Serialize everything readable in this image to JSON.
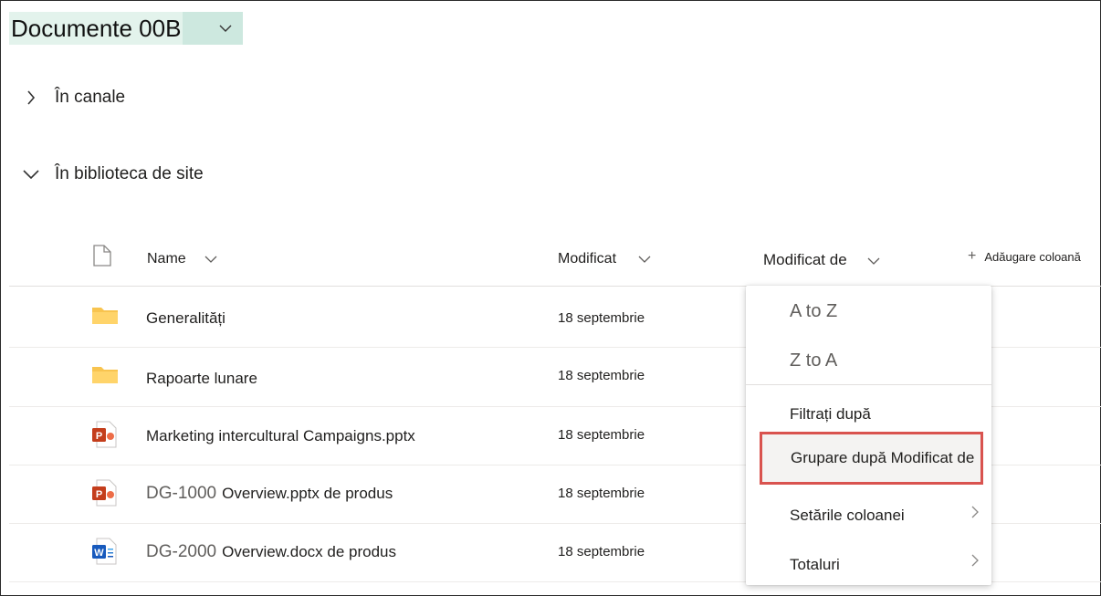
{
  "library_title": "Documente 00B",
  "groups": [
    {
      "label": "În canale",
      "expanded": false
    },
    {
      "label": "În biblioteca de site",
      "expanded": true
    }
  ],
  "columns": {
    "name": "Name",
    "modified": "Modificat",
    "modified_by": "Modificat de",
    "add_column": "Adăugare coloană"
  },
  "rows": [
    {
      "type": "folder",
      "prefix": "",
      "name": "Generalități",
      "modified": "18 septembrie"
    },
    {
      "type": "folder",
      "prefix": "",
      "name": "Rapoarte lunare",
      "modified": "18 septembrie"
    },
    {
      "type": "pptx",
      "prefix": "",
      "name": "Marketing intercultural Campaigns.pptx",
      "modified": "18 septembrie"
    },
    {
      "type": "pptx",
      "prefix": "DG-1000",
      "name": "Overview.pptx de produs",
      "modified": "18 septembrie"
    },
    {
      "type": "docx",
      "prefix": "DG-2000",
      "name": "Overview.docx de produs",
      "modified": "18 septembrie"
    }
  ],
  "column_menu": {
    "sort_az": "A to Z",
    "sort_za": "Z to A",
    "filter": "Filtrați după",
    "group_by": "Grupare după Modificat de",
    "column_settings": "Setările coloanei",
    "totals": "Totaluri"
  },
  "colors": {
    "highlight_border": "#d9534f",
    "title_bg": "#e3f3ec",
    "folder": "#f8c44f",
    "ppt": "#c43e1c",
    "word": "#185abd"
  }
}
